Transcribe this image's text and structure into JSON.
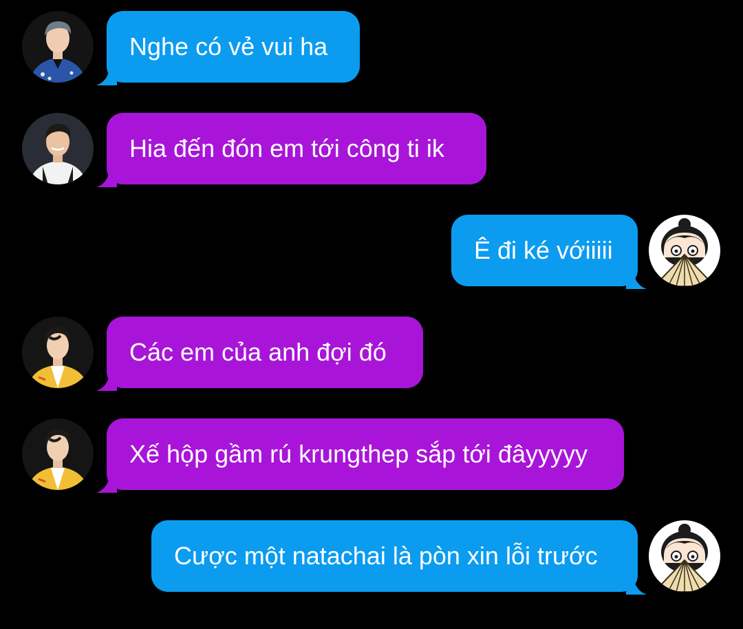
{
  "colors": {
    "background": "#000000",
    "blue_bubble": "#0b9cf0",
    "purple_bubble": "#a815d8",
    "text": "#ffffff"
  },
  "messages": [
    {
      "side": "left",
      "color": "blue",
      "avatar": "avatar-man-blue-jacket",
      "text": "Nghe có vẻ vui ha"
    },
    {
      "side": "left",
      "color": "purple",
      "avatar": "avatar-man-white-shirt",
      "text": "Hia đến đón em tới công ti ik"
    },
    {
      "side": "right",
      "color": "blue",
      "avatar": "avatar-girl-fan-cartoon",
      "text": "Ê đi ké vớiiiii"
    },
    {
      "side": "left",
      "color": "purple",
      "avatar": "avatar-man-yellow-jacket",
      "text": "Các em của anh đợi đó"
    },
    {
      "side": "left",
      "color": "purple",
      "avatar": "avatar-man-yellow-jacket",
      "text": "Xế hộp gầm rú krungthep sắp tới đâyyyyy"
    },
    {
      "side": "right",
      "color": "blue",
      "avatar": "avatar-girl-fan-cartoon",
      "text": "Cược một natachai là pòn xin lỗi trước"
    }
  ]
}
